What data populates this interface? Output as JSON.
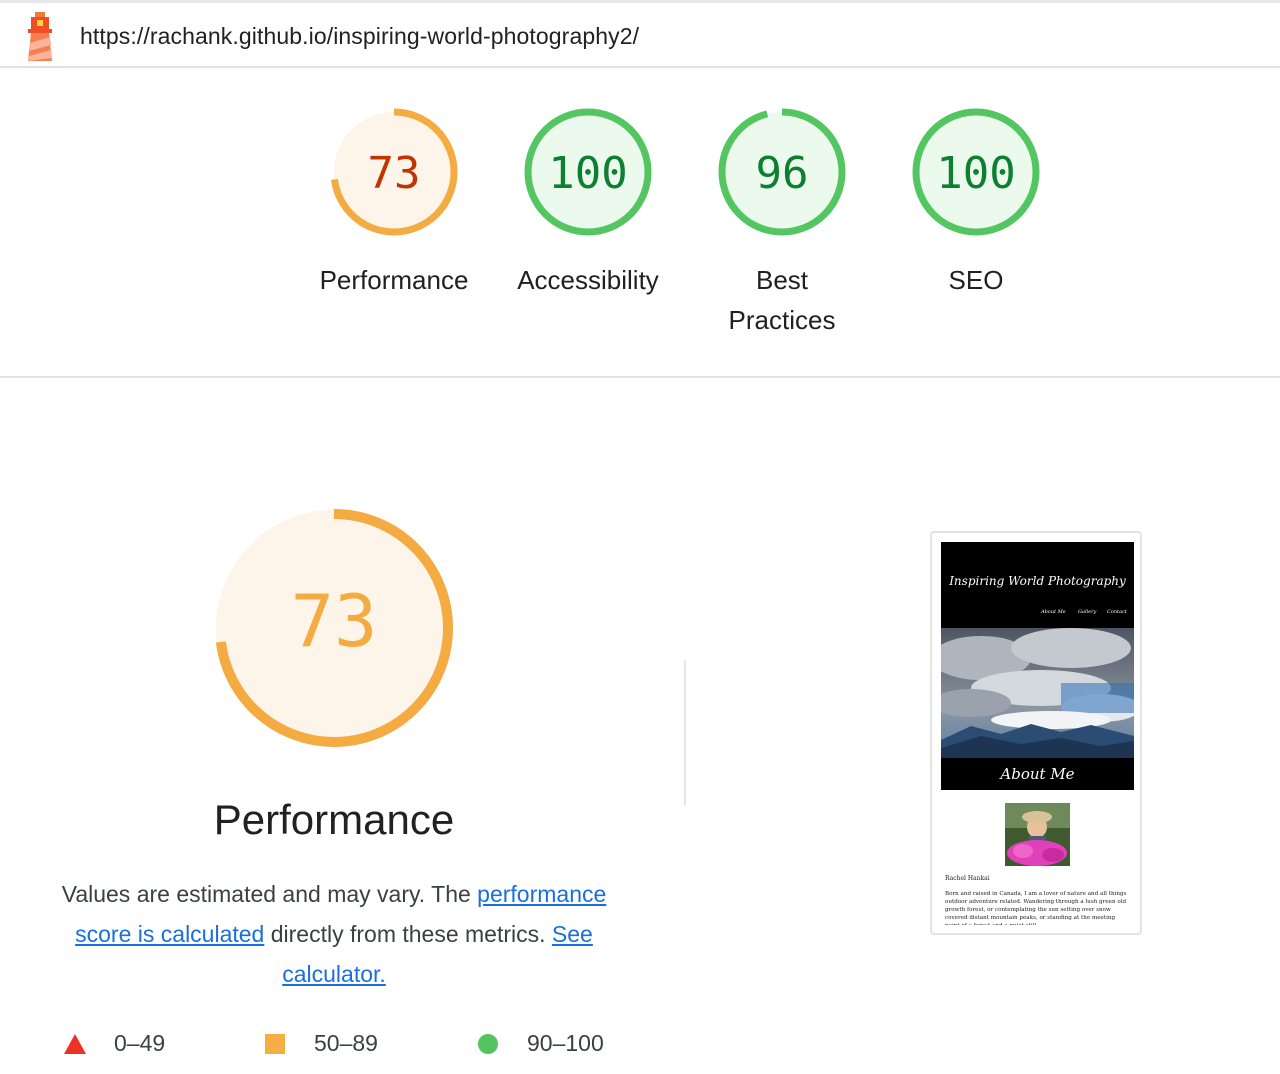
{
  "header": {
    "url": "https://rachank.github.io/inspiring-world-photography2/",
    "logo_icon": "lighthouse-icon"
  },
  "gauges": [
    {
      "score": "73",
      "label": "Performance",
      "value": 73,
      "status": "average"
    },
    {
      "score": "100",
      "label": "Accessibility",
      "value": 100,
      "status": "pass"
    },
    {
      "score": "96",
      "label": "Best Practices",
      "value": 96,
      "status": "pass"
    },
    {
      "score": "100",
      "label": "SEO",
      "value": 100,
      "status": "pass"
    }
  ],
  "performance": {
    "score": "73",
    "value": 73,
    "title": "Performance",
    "desc_prefix": "Values are estimated and may vary. The ",
    "link1": "performance score is calculated",
    "desc_middle": " directly from these metrics. ",
    "link2": "See calculator."
  },
  "legend": [
    {
      "icon": "triangle-icon",
      "range": "0–49",
      "color": "#eb3323"
    },
    {
      "icon": "square-icon",
      "range": "50–89",
      "color": "#f6ae43"
    },
    {
      "icon": "circle-icon",
      "range": "90–100",
      "color": "#54c461"
    }
  ],
  "colors": {
    "pass": "#0c8030",
    "pass_ring": "#53c661",
    "pass_fill": "#ecf9ed",
    "average": "#c33300",
    "average_ring": "#f3ab42",
    "average_fill": "#fdf4ea",
    "link": "#1a6fe0"
  },
  "screenshot": {
    "site_title": "Inspiring World Photography",
    "nav": [
      "About Me",
      "Gallery",
      "Contact"
    ],
    "section_title": "About Me",
    "name": "Rachel Hankai",
    "bio": "Born and raised in Canada, I am a lover of nature and all things outdoor adventure related. Wandering through a lush green old growth forest, or contemplating the sun setting over snow covered distant mountain peaks, or standing at the meeting point of a forest and a quiet still"
  }
}
